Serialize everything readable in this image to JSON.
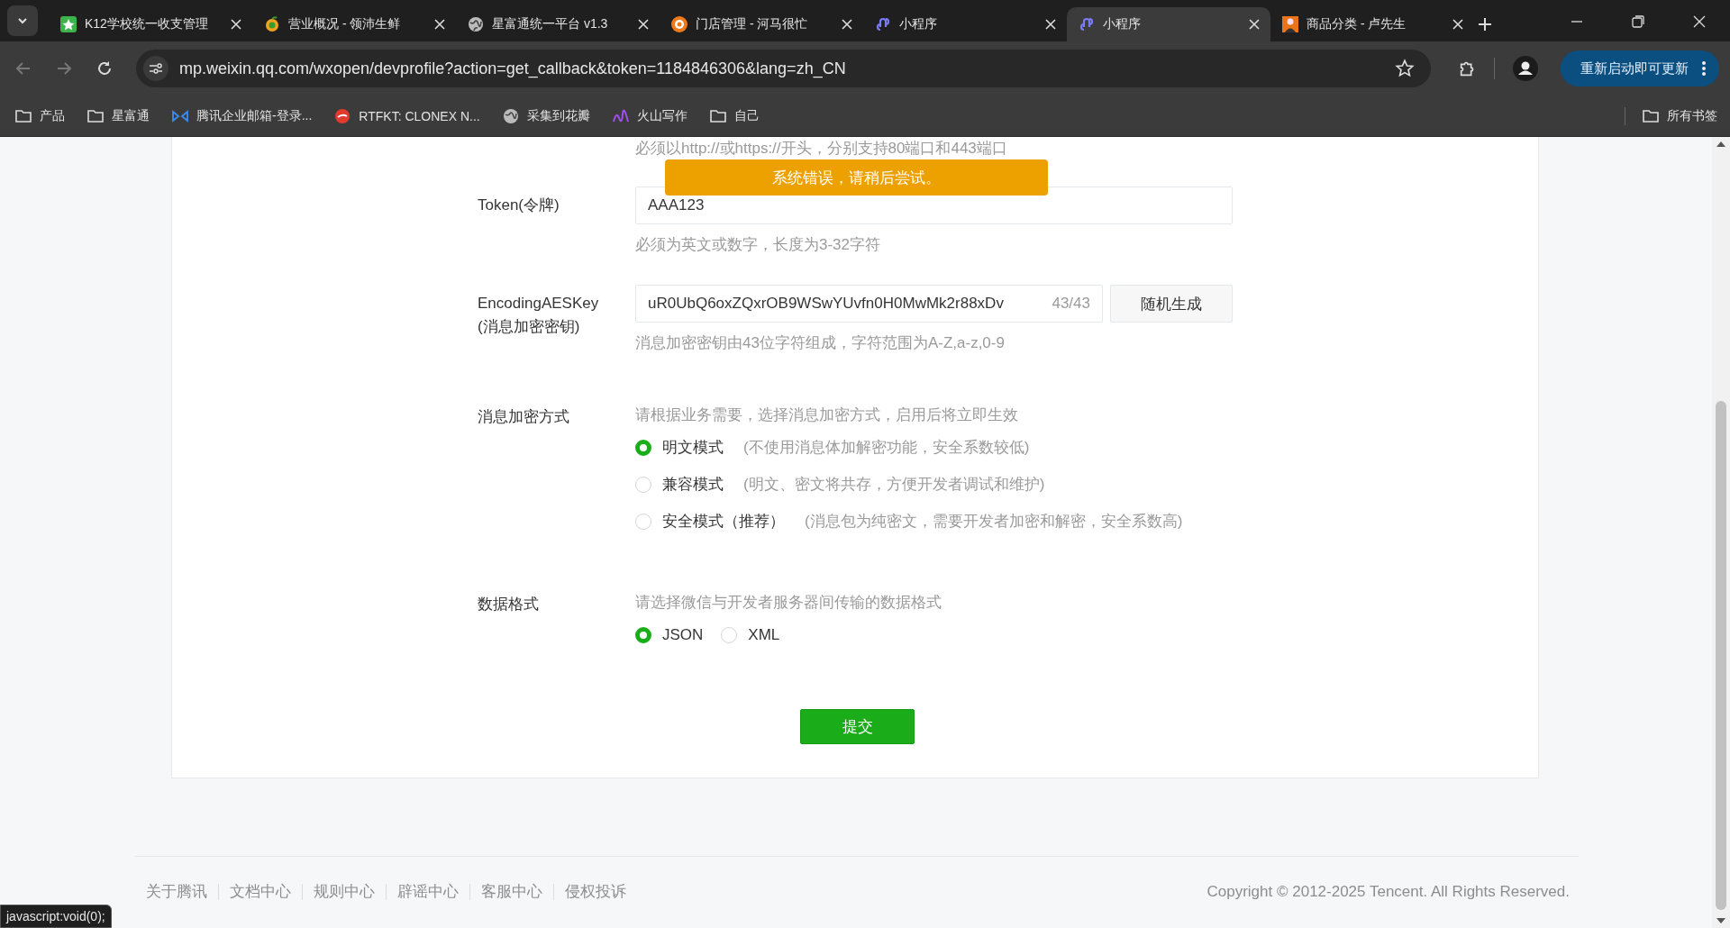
{
  "browser": {
    "tabs": [
      {
        "title": "K12学校统一收支管理",
        "selected": false
      },
      {
        "title": "营业概况 - 领沛生鲜",
        "selected": false
      },
      {
        "title": "星富通统一平台 v1.3",
        "selected": false
      },
      {
        "title": "门店管理 - 河马很忙",
        "selected": false
      },
      {
        "title": "小程序",
        "selected": false
      },
      {
        "title": "小程序",
        "selected": true
      },
      {
        "title": "商品分类 - 卢先生",
        "selected": false
      }
    ],
    "url": "mp.weixin.qq.com/wxopen/devprofile?action=get_callback&token=1184846306&lang=zh_CN",
    "update_button": "重新启动即可更新",
    "bookmarks": [
      {
        "label": "产品"
      },
      {
        "label": "星富通"
      },
      {
        "label": "腾讯企业邮箱-登录..."
      },
      {
        "label": "RTFKT: CLONEX N..."
      },
      {
        "label": "采集到花瓣"
      },
      {
        "label": "火山写作"
      },
      {
        "label": "自己"
      }
    ],
    "all_bookmarks": "所有书签"
  },
  "page": {
    "top_hint": "必须以http://或https://开头，分别支持80端口和443端口",
    "toast": "系统错误，请稍后尝试。",
    "token": {
      "label": "Token(令牌)",
      "value": "AAA123",
      "hint": "必须为英文或数字，长度为3-32字符"
    },
    "aes_key": {
      "label_lines": [
        "EncodingAESKey",
        "(消息加密密钥)"
      ],
      "value": "uR0UbQ6oxZQxrOB9WSwYUvfn0H0MwMk2r88xDv",
      "count": "43/43",
      "button": "随机生成",
      "hint": "消息加密密钥由43位字符组成，字符范围为A-Z,a-z,0-9"
    },
    "encryption": {
      "label": "消息加密方式",
      "description": "请根据业务需要，选择消息加密方式，启用后将立即生效",
      "options": [
        {
          "label": "明文模式",
          "note": "(不使用消息体加解密功能，安全系数较低)",
          "selected": true
        },
        {
          "label": "兼容模式",
          "note": "(明文、密文将共存，方便开发者调试和维护)",
          "selected": false
        },
        {
          "label": "安全模式（推荐）",
          "note": "(消息包为纯密文，需要开发者加密和解密，安全系数高)",
          "selected": false
        }
      ]
    },
    "data_format": {
      "label": "数据格式",
      "description": "请选择微信与开发者服务器间传输的数据格式",
      "options": [
        {
          "label": "JSON",
          "selected": true
        },
        {
          "label": "XML",
          "selected": false
        }
      ]
    },
    "submit": "提交"
  },
  "footer": {
    "links": [
      "关于腾讯",
      "文档中心",
      "规则中心",
      "辟谣中心",
      "客服中心",
      "侵权投诉"
    ],
    "copyright": "Copyright © 2012-2025 Tencent. All Rights Reserved."
  },
  "status_url": "javascript:void(0);"
}
